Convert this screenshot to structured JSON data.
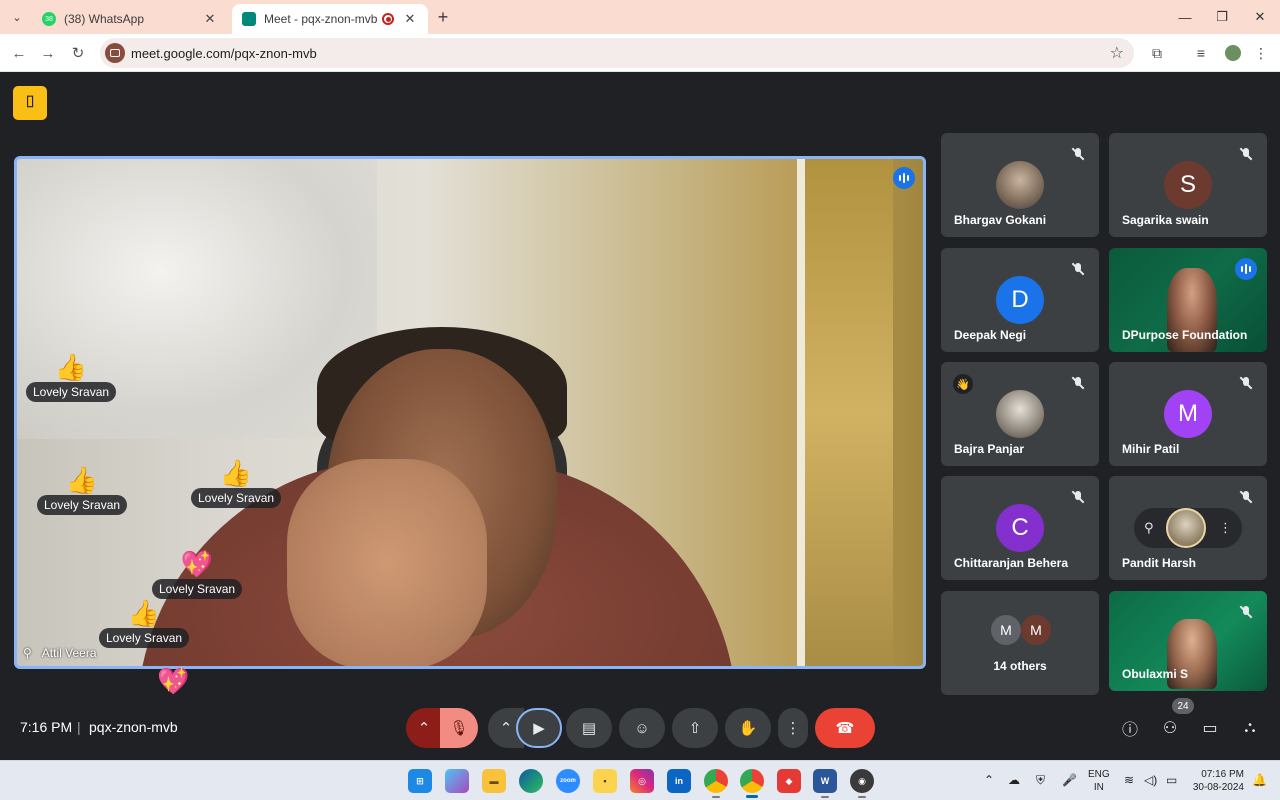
{
  "browser": {
    "tabs": [
      {
        "title": "(38) WhatsApp",
        "badge": "38",
        "favicon_color": "#25d366"
      },
      {
        "title": "Meet - pqx-znon-mvb",
        "favicon_color": "#00897b"
      }
    ],
    "url": "meet.google.com/pqx-znon-mvb"
  },
  "meet": {
    "main_speaker": {
      "name": "Attil Veera"
    },
    "reactions": [
      {
        "emoji": "👍",
        "name": "Lovely Sravan"
      },
      {
        "emoji": "👍",
        "name": "Lovely Sravan"
      },
      {
        "emoji": "👍",
        "name": "Lovely Sravan"
      },
      {
        "emoji": "💖",
        "name": "Lovely Sravan"
      },
      {
        "emoji": "👍",
        "name": "Lovely Sravan"
      },
      {
        "emoji": "💖",
        "name": ""
      }
    ],
    "participants": [
      {
        "name": "Bhargav Gokani",
        "avatar": "photo",
        "muted": true
      },
      {
        "name": "Sagarika swain",
        "initial": "S",
        "color": "#6d3a2f",
        "muted": true
      },
      {
        "name": "Deepak Negi",
        "initial": "D",
        "color": "#1a73e8",
        "muted": true
      },
      {
        "name": "DPurpose Foundation",
        "avatar": "video",
        "speaking": true
      },
      {
        "name": "Bajra Panjar",
        "avatar": "photo",
        "muted": true,
        "hand_raised": true,
        "hand_emoji": "👋"
      },
      {
        "name": "Mihir Patil",
        "initial": "M",
        "color": "#a142f4",
        "muted": true
      },
      {
        "name": "Chittaranjan Behera",
        "initial": "C",
        "color": "#8430ce",
        "muted": true
      },
      {
        "name": "Pandit Harsh",
        "avatar": "photo",
        "muted": true,
        "pinned_overlay": true
      },
      {
        "name": "14 others",
        "initials": [
          "M",
          "M"
        ],
        "colors": [
          "#5f6368",
          "#6d3a2f"
        ]
      },
      {
        "name": "Obulaxmi S",
        "avatar": "video",
        "muted": true
      }
    ],
    "time": "7:16 PM",
    "separator": "|",
    "meeting_code": "pqx-znon-mvb",
    "participant_count": "24"
  },
  "taskbar": {
    "lang_line1": "ENG",
    "lang_line2": "IN",
    "time": "07:16 PM",
    "date": "30-08-2024"
  },
  "colors": {
    "accent": "#8ab4f8",
    "end_call": "#ea4335",
    "meet_logo": "#f9bf15"
  }
}
